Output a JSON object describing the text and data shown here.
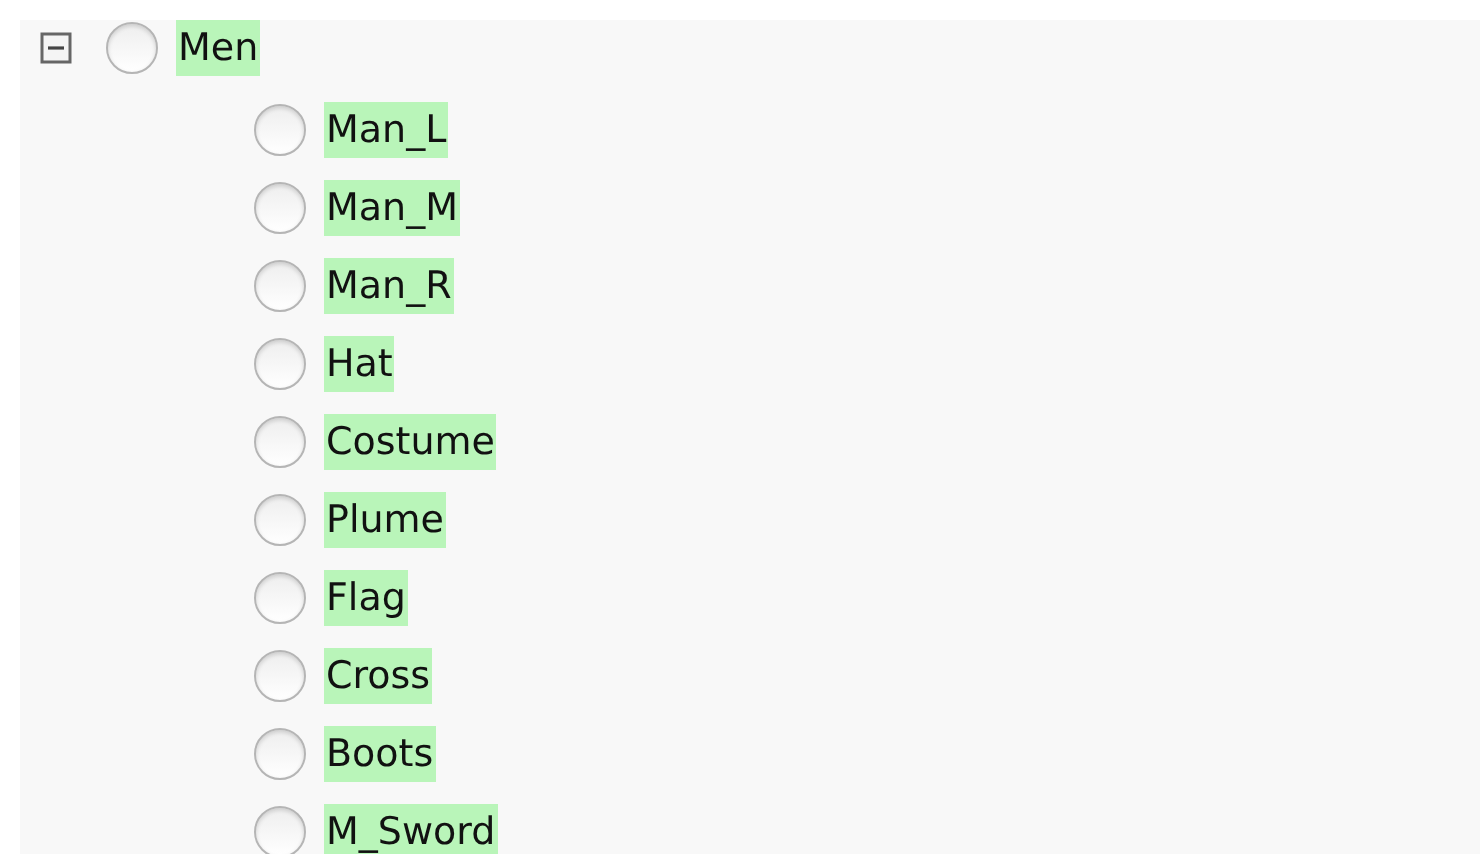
{
  "tree": [
    {
      "label": "Men",
      "expanded": true,
      "selected": false,
      "children": [
        {
          "label": "Man_L",
          "selected": false
        },
        {
          "label": "Man_M",
          "selected": false
        },
        {
          "label": "Man_R",
          "selected": false
        },
        {
          "label": "Hat",
          "selected": false
        },
        {
          "label": "Costume",
          "selected": false
        },
        {
          "label": "Plume",
          "selected": false
        },
        {
          "label": "Flag",
          "selected": false
        },
        {
          "label": "Cross",
          "selected": false
        },
        {
          "label": "Boots",
          "selected": false
        },
        {
          "label": "M_Sword",
          "selected": false
        }
      ]
    }
  ]
}
